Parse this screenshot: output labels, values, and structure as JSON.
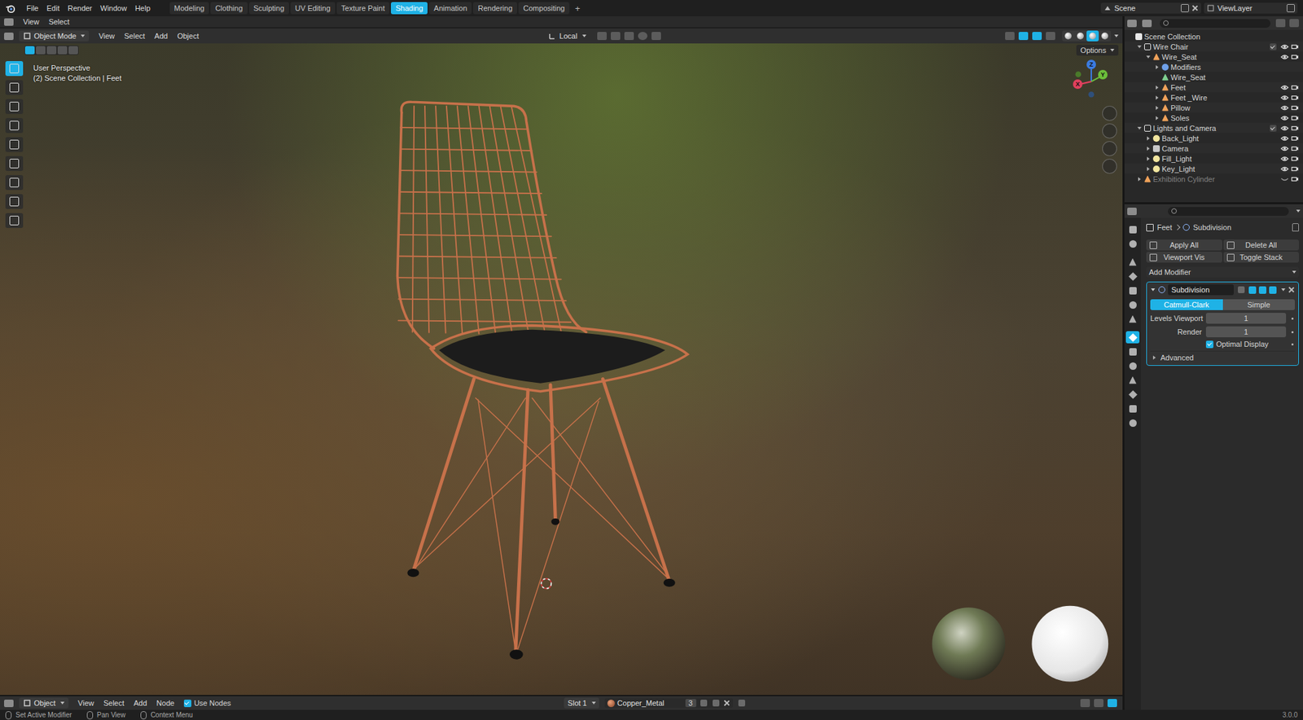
{
  "menu": [
    "File",
    "Edit",
    "Render",
    "Window",
    "Help"
  ],
  "workspaces": [
    {
      "label": "Modeling",
      "selected": false
    },
    {
      "label": "Clothing",
      "selected": false
    },
    {
      "label": "Sculpting",
      "selected": false
    },
    {
      "label": "UV Editing",
      "selected": false
    },
    {
      "label": "Texture Paint",
      "selected": false
    },
    {
      "label": "Shading",
      "selected": true
    },
    {
      "label": "Animation",
      "selected": false
    },
    {
      "label": "Rendering",
      "selected": false
    },
    {
      "label": "Compositing",
      "selected": false
    }
  ],
  "add_workspace": "+",
  "scene": "Scene",
  "view_layer": "ViewLayer",
  "top_area": {
    "menus": [
      "View",
      "Select"
    ]
  },
  "viewport": {
    "mode": "Object Mode",
    "menus": [
      "View",
      "Select",
      "Add",
      "Object"
    ],
    "orientation": "Local",
    "options": "Options",
    "overlay_lines": [
      "User Perspective",
      "(2) Scene Collection | Feet"
    ],
    "gizmo_axes": [
      {
        "label": "Z",
        "color": "#3b7be0"
      },
      {
        "label": "Y",
        "color": "#6cbf3a"
      },
      {
        "label": "X",
        "color": "#e0405e"
      }
    ],
    "tools": [
      {
        "selected": true
      },
      {
        "selected": false
      },
      {
        "selected": false
      },
      {
        "selected": false
      },
      {
        "selected": false
      },
      {
        "selected": false
      },
      {
        "selected": false
      },
      {
        "selected": false
      },
      {
        "selected": false
      }
    ],
    "select_modes": [
      {
        "selected": true
      },
      {
        "selected": false
      },
      {
        "selected": false
      },
      {
        "selected": false
      },
      {
        "selected": false
      }
    ],
    "shading_modes": [
      {
        "selected": false
      },
      {
        "selected": false
      },
      {
        "selected": true
      },
      {
        "selected": false
      }
    ]
  },
  "outliner": {
    "items": [
      {
        "label": "Scene Collection",
        "depth": 0,
        "kind": "scene",
        "leaf": true,
        "expanded": false,
        "visible": true,
        "disabled": false
      },
      {
        "label": "Wire Chair",
        "depth": 1,
        "kind": "collection",
        "leaf": false,
        "expanded": true,
        "visible": true,
        "disabled": false
      },
      {
        "label": "Wire_Seat",
        "depth": 2,
        "kind": "object",
        "leaf": false,
        "expanded": true,
        "visible": true,
        "disabled": false
      },
      {
        "label": "Modifiers",
        "depth": 3,
        "kind": "modifiers",
        "leaf": false,
        "expanded": false,
        "visible": true,
        "disabled": false
      },
      {
        "label": "Wire_Seat",
        "depth": 3,
        "kind": "mesh",
        "leaf": true,
        "expanded": false,
        "visible": true,
        "disabled": false
      },
      {
        "label": "Feet",
        "depth": 3,
        "kind": "object",
        "leaf": false,
        "expanded": false,
        "visible": true,
        "disabled": false
      },
      {
        "label": "Feet _Wire",
        "depth": 3,
        "kind": "object",
        "leaf": false,
        "expanded": false,
        "visible": true,
        "disabled": false
      },
      {
        "label": "Pillow",
        "depth": 3,
        "kind": "object",
        "leaf": false,
        "expanded": false,
        "visible": true,
        "disabled": false
      },
      {
        "label": "Soles",
        "depth": 3,
        "kind": "object",
        "leaf": false,
        "expanded": false,
        "visible": true,
        "disabled": false
      },
      {
        "label": "Lights and Camera",
        "depth": 1,
        "kind": "collection",
        "leaf": false,
        "expanded": true,
        "visible": true,
        "disabled": false
      },
      {
        "label": "Back_Light",
        "depth": 2,
        "kind": "light",
        "leaf": false,
        "expanded": false,
        "visible": true,
        "disabled": false
      },
      {
        "label": "Camera",
        "depth": 2,
        "kind": "camera",
        "leaf": false,
        "expanded": false,
        "visible": true,
        "disabled": false
      },
      {
        "label": "Fill_Light",
        "depth": 2,
        "kind": "light",
        "leaf": false,
        "expanded": false,
        "visible": true,
        "disabled": false
      },
      {
        "label": "Key_Light",
        "depth": 2,
        "kind": "light",
        "leaf": false,
        "expanded": false,
        "visible": true,
        "disabled": false
      },
      {
        "label": "Exhibition Cylinder",
        "depth": 1,
        "kind": "object",
        "leaf": false,
        "expanded": false,
        "visible": false,
        "disabled": true
      }
    ]
  },
  "properties": {
    "tabs": [
      {
        "selected": false
      },
      {
        "selected": false
      },
      {
        "selected": false
      },
      {
        "selected": false
      },
      {
        "selected": false
      },
      {
        "selected": false
      },
      {
        "selected": false
      },
      {
        "selected": true
      },
      {
        "selected": false
      },
      {
        "selected": false
      },
      {
        "selected": false
      },
      {
        "selected": false
      },
      {
        "selected": false
      },
      {
        "selected": false
      }
    ],
    "breadcrumb": [
      "Feet",
      "Subdivision"
    ],
    "actions": [
      "Apply All",
      "Delete All",
      "Viewport Vis",
      "Toggle Stack"
    ],
    "add_modifier": "Add Modifier",
    "modifier": {
      "name": "Subdivision",
      "expanded": true,
      "toggles": [
        true,
        true,
        true
      ],
      "methods": [
        {
          "label": "Catmull-Clark",
          "selected": true
        },
        {
          "label": "Simple",
          "selected": false
        }
      ],
      "fields": [
        {
          "label": "Levels Viewport",
          "value": "1"
        },
        {
          "label": "Render",
          "value": "1"
        }
      ],
      "optimal_display": {
        "label": "Optimal Display",
        "checked": true
      },
      "advanced": {
        "label": "Advanced",
        "expanded": false
      }
    }
  },
  "node_header": {
    "editor": "Object",
    "menus": [
      "View",
      "Select",
      "Add",
      "Node"
    ],
    "use_nodes": {
      "label": "Use Nodes",
      "checked": true
    },
    "slot": "Slot 1",
    "material": "Copper_Metal",
    "users": "3"
  },
  "status_bar": {
    "items": [
      "Set Active Modifier",
      "Pan View",
      "Context Menu"
    ],
    "version": "3.0.0"
  }
}
